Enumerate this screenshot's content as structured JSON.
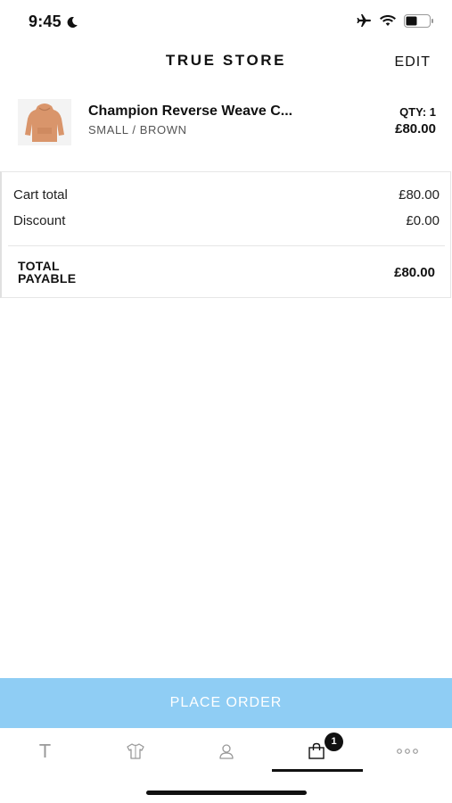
{
  "status_bar": {
    "time": "9:45"
  },
  "header": {
    "title": "TRUE STORE",
    "edit_label": "EDIT"
  },
  "cart_item": {
    "name": "Champion Reverse Weave C...",
    "variant": "SMALL / BROWN",
    "qty_label": "QTY: 1",
    "price": "£80.00",
    "thumbnail_color": "#d9956b"
  },
  "summary": {
    "cart_total_label": "Cart total",
    "cart_total_value": "£80.00",
    "discount_label": "Discount",
    "discount_value": "£0.00",
    "total_label_line1": "TOTAL",
    "total_label_line2": "PAYABLE",
    "total_value": "£80.00"
  },
  "place_order": {
    "label": "PLACE ORDER",
    "color": "#8fcdf4"
  },
  "tab_bar": {
    "tabs": [
      {
        "name": "home",
        "icon": "T",
        "active": false
      },
      {
        "name": "catalog",
        "icon": "shirt-icon",
        "active": false
      },
      {
        "name": "account",
        "icon": "person-icon",
        "active": false
      },
      {
        "name": "cart",
        "icon": "bag-icon",
        "active": true
      },
      {
        "name": "more",
        "icon": "more-icon",
        "active": false
      }
    ],
    "cart_badge": "1"
  }
}
